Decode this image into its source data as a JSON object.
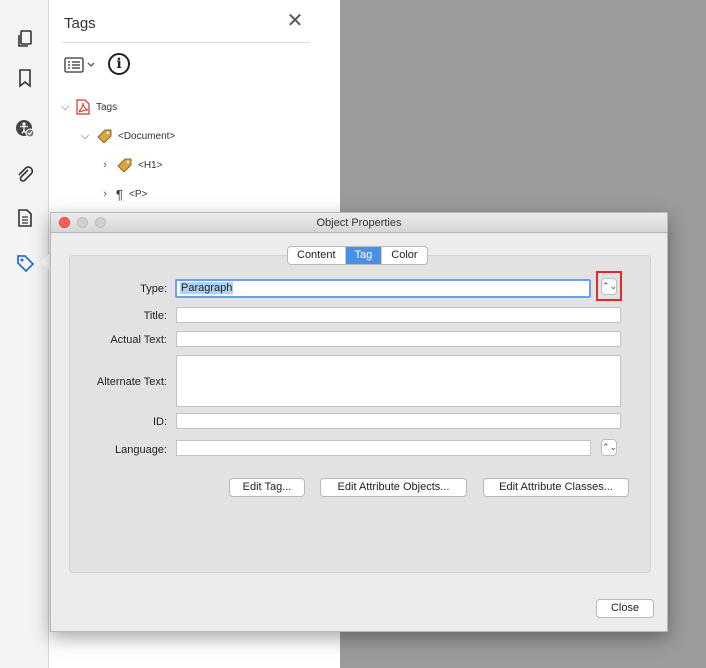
{
  "tags_panel": {
    "title": "Tags",
    "close_glyph": "✕",
    "info_glyph": "i",
    "tree": [
      {
        "label": "Tags",
        "icon": "pdf-icon",
        "expanded": true
      },
      {
        "label": "<Document>",
        "icon": "tag-icon",
        "expanded": true
      },
      {
        "label": "<H1>",
        "icon": "tag-icon",
        "expanded": false
      },
      {
        "label": "<P>",
        "icon": "paragraph-icon",
        "expanded": false
      }
    ]
  },
  "rail": {
    "icons": [
      "pages-icon",
      "bookmark-icon",
      "accessibility-icon",
      "attachment-icon",
      "content-icon",
      "tags-icon"
    ]
  },
  "dialog": {
    "title": "Object Properties",
    "tabs": [
      {
        "label": "Content",
        "active": false
      },
      {
        "label": "Tag",
        "active": true
      },
      {
        "label": "Color",
        "active": false
      }
    ],
    "fields": {
      "type_label": "Type:",
      "type_value": "Paragraph",
      "title_label": "Title:",
      "title_value": "",
      "actual_text_label": "Actual Text:",
      "actual_text_value": "",
      "alternate_text_label": "Alternate Text:",
      "alternate_text_value": "",
      "id_label": "ID:",
      "id_value": "",
      "language_label": "Language:",
      "language_value": ""
    },
    "buttons": {
      "edit_tag": "Edit Tag...",
      "edit_attribute_objects": "Edit Attribute Objects...",
      "edit_attribute_classes": "Edit Attribute Classes...",
      "close": "Close"
    }
  },
  "colors": {
    "accent": "#4a90e2",
    "highlight": "#e0292b",
    "doc_background": "#9b9b9b"
  }
}
